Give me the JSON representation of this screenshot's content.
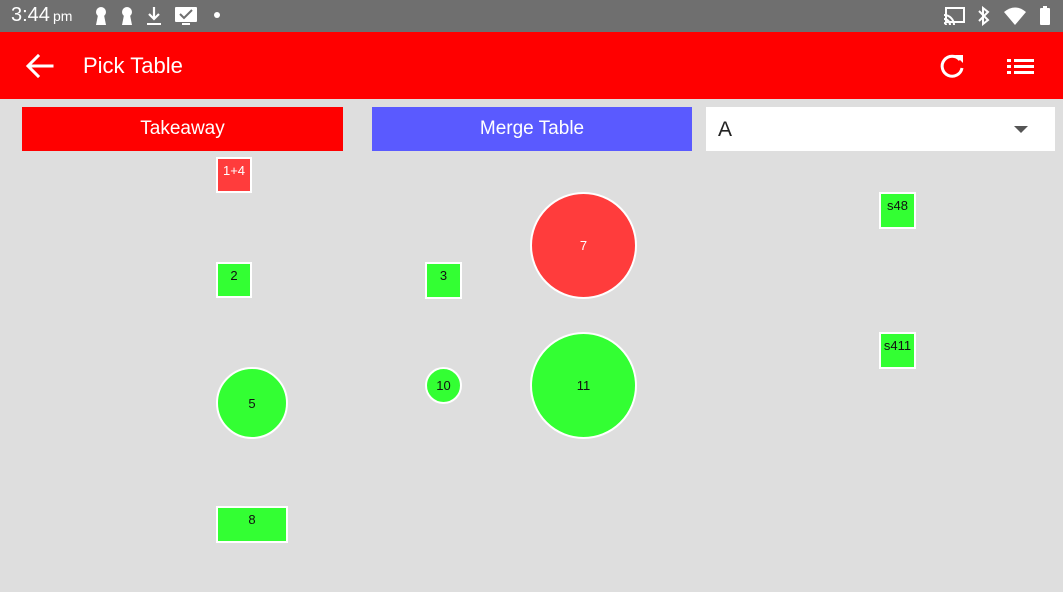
{
  "status_bar": {
    "time": "3:44",
    "ampm": "pm",
    "left_icons": [
      "keyhole-icon",
      "keyhole-icon",
      "download-icon",
      "message-icon",
      "dot-icon"
    ],
    "right_icons": [
      "cast-icon",
      "bluetooth-icon",
      "wifi-icon",
      "battery-icon"
    ]
  },
  "app_bar": {
    "title": "Pick Table",
    "back_icon": "arrow-left-icon",
    "refresh_icon": "refresh-icon",
    "list_icon": "list-icon"
  },
  "actions": {
    "takeaway_label": "Takeaway",
    "merge_label": "Merge Table"
  },
  "area_select": {
    "value": "A"
  },
  "colors": {
    "app_bar": "#ff0000",
    "merge_button": "#5a5aff",
    "table_free": "#33ff33",
    "table_occupied": "#ff3c3c",
    "background": "#dedede"
  },
  "tables": [
    {
      "label": "1+4",
      "status": "occupied"
    },
    {
      "label": "2",
      "status": "free"
    },
    {
      "label": "5",
      "status": "free"
    },
    {
      "label": "8",
      "status": "free"
    },
    {
      "label": "3",
      "status": "free"
    },
    {
      "label": "10",
      "status": "free"
    },
    {
      "label": "7",
      "status": "occupied"
    },
    {
      "label": "11",
      "status": "free"
    },
    {
      "label": "s48",
      "status": "free"
    },
    {
      "label": "s411",
      "status": "free"
    }
  ]
}
